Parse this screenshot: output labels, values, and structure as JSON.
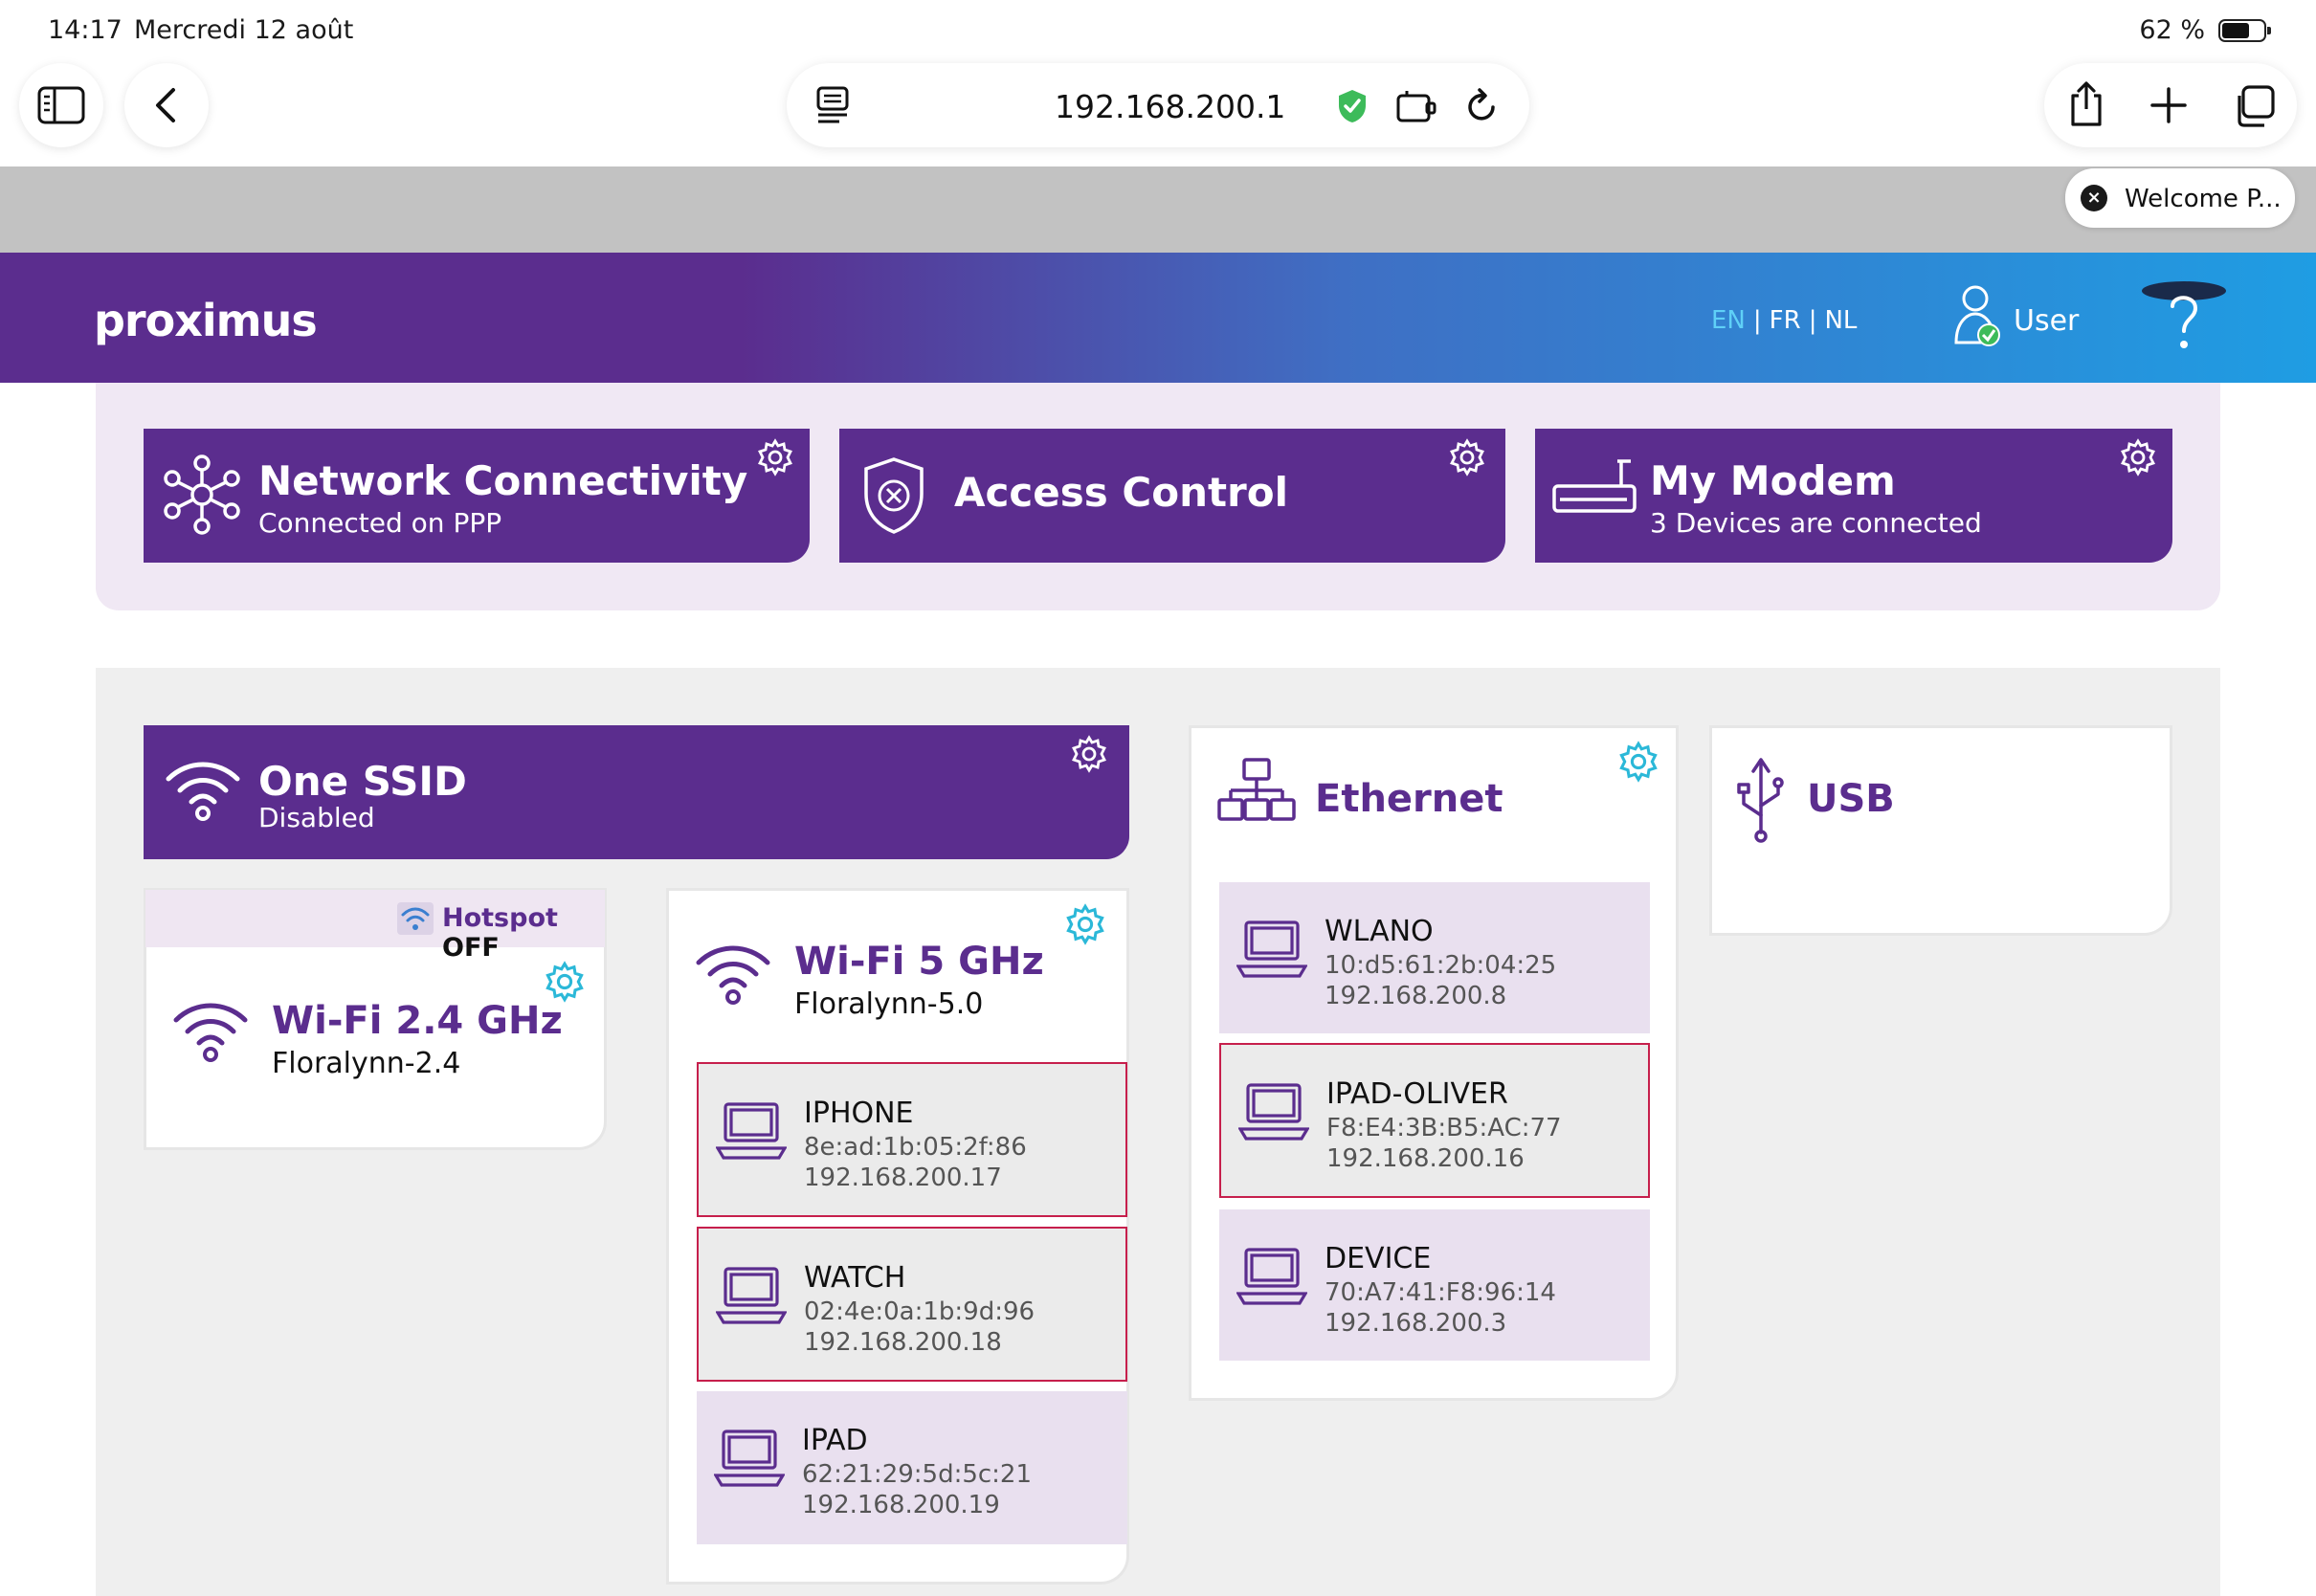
{
  "status_bar": {
    "time": "14:17",
    "date": "Mercredi 12 août",
    "battery": "62 %"
  },
  "browser": {
    "url": "192.168.200.1",
    "tab_title": "Welcome P..."
  },
  "header": {
    "logo": "proximus",
    "lang_en": "EN",
    "lang_fr": "FR",
    "lang_nl": "NL",
    "user_label": "User"
  },
  "tiles": {
    "network": {
      "title": "Network Connectivity",
      "subtitle": "Connected on PPP"
    },
    "access": {
      "title": "Access Control"
    },
    "modem": {
      "title": "My Modem",
      "subtitle": "3 Devices are connected"
    }
  },
  "one_ssid": {
    "title": "One SSID",
    "subtitle": "Disabled"
  },
  "hotspot": {
    "label": "Hotspot",
    "state": "OFF"
  },
  "wifi24": {
    "title": "Wi-Fi 2.4 GHz",
    "ssid": "Floralynn-2.4"
  },
  "wifi5": {
    "title": "Wi-Fi 5 GHz",
    "ssid": "Floralynn-5.0",
    "devices": [
      {
        "name": "IPHONE",
        "mac": "8e:ad:1b:05:2f:86",
        "ip": "192.168.200.17"
      },
      {
        "name": "WATCH",
        "mac": "02:4e:0a:1b:9d:96",
        "ip": "192.168.200.18"
      },
      {
        "name": "IPAD",
        "mac": "62:21:29:5d:5c:21",
        "ip": "192.168.200.19"
      }
    ]
  },
  "ethernet": {
    "title": "Ethernet",
    "devices": [
      {
        "name": "WLANO",
        "mac": "10:d5:61:2b:04:25",
        "ip": "192.168.200.8"
      },
      {
        "name": "IPAD-OLIVER",
        "mac": "F8:E4:3B:B5:AC:77",
        "ip": "192.168.200.16"
      },
      {
        "name": "DEVICE",
        "mac": "70:A7:41:F8:96:14",
        "ip": "192.168.200.3"
      }
    ]
  },
  "usb": {
    "title": "USB"
  },
  "colors": {
    "brand_purple": "#5b2d8e",
    "accent_blue": "#1f9de3",
    "selected_border": "#c61f4c"
  }
}
